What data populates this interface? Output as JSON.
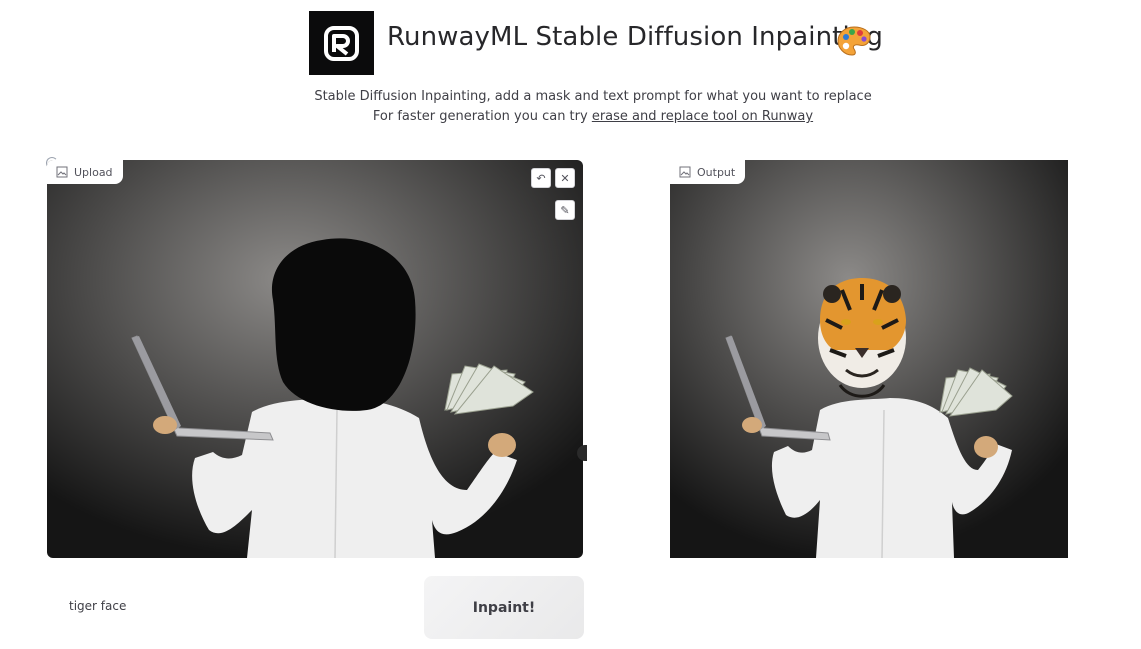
{
  "header": {
    "title": "RunwayML Stable Diffusion Inpainting",
    "title_emoji": "palette-icon",
    "description_line1": "Stable Diffusion Inpainting, add a mask and text prompt for what you want to replace",
    "description_line2_prefix": "For faster generation you can try ",
    "description_link": "erase and replace tool on Runway"
  },
  "upload": {
    "label": "Upload",
    "buttons": [
      "undo-icon",
      "close-icon",
      "brush-icon"
    ]
  },
  "output": {
    "label": "Output"
  },
  "prompt": {
    "value": "tiger face"
  },
  "run_button": {
    "label": "Inpaint!"
  },
  "colors": {
    "logo_bg": "#0b0b0c",
    "mask": "#0a0a0a",
    "button_bg": "#f4f4f5"
  }
}
